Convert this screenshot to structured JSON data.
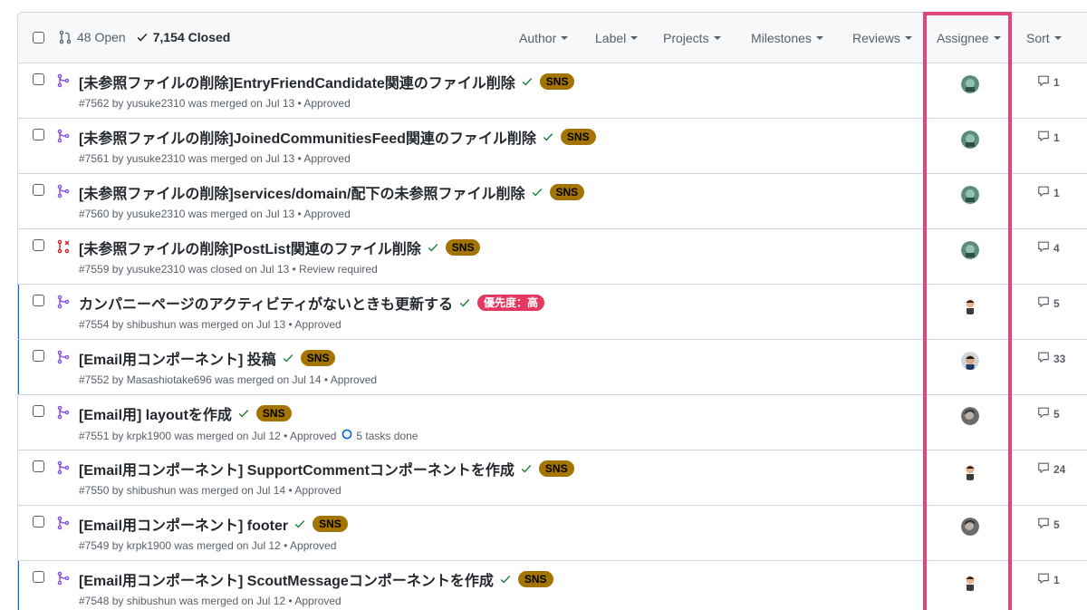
{
  "header": {
    "open_label": "48 Open",
    "closed_label": "7,154 Closed",
    "filters": [
      {
        "name": "author",
        "label": "Author"
      },
      {
        "name": "label",
        "label": "Label"
      },
      {
        "name": "projects",
        "label": "Projects"
      },
      {
        "name": "milestones",
        "label": "Milestones"
      },
      {
        "name": "reviews",
        "label": "Reviews"
      },
      {
        "name": "assignee",
        "label": "Assignee"
      },
      {
        "name": "sort",
        "label": "Sort"
      }
    ]
  },
  "colors": {
    "merged": "#8250df",
    "closed": "#cf222e",
    "check": "#1a7f37",
    "sns_label": "#a37400",
    "priority_label": "#e4385f",
    "highlight": "#e0457b",
    "unread_bar": "#0969da"
  },
  "pulls": [
    {
      "title": "[未参照ファイルの削除]EntryFriendCandidate関連のファイル削除",
      "state": "merged",
      "label": "SNS",
      "label_color": "#a37400",
      "label_text_color": "#000000",
      "meta": "#7562 by yusuke2310 was merged on Jul 13 • Approved",
      "tasks": "",
      "comments": "1",
      "avatar": "avatar-teal",
      "unread": false
    },
    {
      "title": "[未参照ファイルの削除]JoinedCommunitiesFeed関連のファイル削除",
      "state": "merged",
      "label": "SNS",
      "label_color": "#a37400",
      "label_text_color": "#000000",
      "meta": "#7561 by yusuke2310 was merged on Jul 13 • Approved",
      "tasks": "",
      "comments": "1",
      "avatar": "avatar-teal",
      "unread": false
    },
    {
      "title": "[未参照ファイルの削除]services/domain/配下の未参照ファイル削除",
      "state": "merged",
      "label": "SNS",
      "label_color": "#a37400",
      "label_text_color": "#000000",
      "meta": "#7560 by yusuke2310 was merged on Jul 13 • Approved",
      "tasks": "",
      "comments": "1",
      "avatar": "avatar-teal",
      "unread": false
    },
    {
      "title": "[未参照ファイルの削除]PostList関連のファイル削除",
      "state": "closed",
      "label": "SNS",
      "label_color": "#a37400",
      "label_text_color": "#000000",
      "meta": "#7559 by yusuke2310 was closed on Jul 13 • Review required",
      "tasks": "",
      "comments": "4",
      "avatar": "avatar-teal",
      "unread": false
    },
    {
      "title": "カンパニーページのアクティビティがないときも更新する",
      "state": "merged",
      "label": "優先度：高",
      "label_color": "#e4385f",
      "label_text_color": "#ffffff",
      "meta": "#7554 by shibushun was merged on Jul 13 • Approved",
      "tasks": "",
      "comments": "5",
      "avatar": "avatar-person",
      "unread": true
    },
    {
      "title": "[Email用コンポーネント] 投稿",
      "state": "merged",
      "label": "SNS",
      "label_color": "#a37400",
      "label_text_color": "#000000",
      "meta": "#7552 by Masashiotake696 was merged on Jul 14 • Approved",
      "tasks": "",
      "comments": "33",
      "avatar": "avatar-dark",
      "unread": true
    },
    {
      "title": "[Email用] layoutを作成",
      "state": "merged",
      "label": "SNS",
      "label_color": "#a37400",
      "label_text_color": "#000000",
      "meta": "#7551 by krpk1900 was merged on Jul 12 • Approved",
      "tasks": "5 tasks done",
      "comments": "5",
      "avatar": "avatar-gray",
      "unread": false
    },
    {
      "title": "[Email用コンポーネント] SupportCommentコンポーネントを作成",
      "state": "merged",
      "label": "SNS",
      "label_color": "#a37400",
      "label_text_color": "#000000",
      "meta": "#7550 by shibushun was merged on Jul 14 • Approved",
      "tasks": "",
      "comments": "24",
      "avatar": "avatar-person",
      "unread": false
    },
    {
      "title": "[Email用コンポーネント] footer",
      "state": "merged",
      "label": "SNS",
      "label_color": "#a37400",
      "label_text_color": "#000000",
      "meta": "#7549 by krpk1900 was merged on Jul 12 • Approved",
      "tasks": "",
      "comments": "5",
      "avatar": "avatar-gray",
      "unread": false
    },
    {
      "title": "[Email用コンポーネント] ScoutMessageコンポーネントを作成",
      "state": "merged",
      "label": "SNS",
      "label_color": "#a37400",
      "label_text_color": "#000000",
      "meta": "#7548 by shibushun was merged on Jul 12 • Approved",
      "tasks": "",
      "comments": "1",
      "avatar": "avatar-person",
      "unread": true
    }
  ]
}
